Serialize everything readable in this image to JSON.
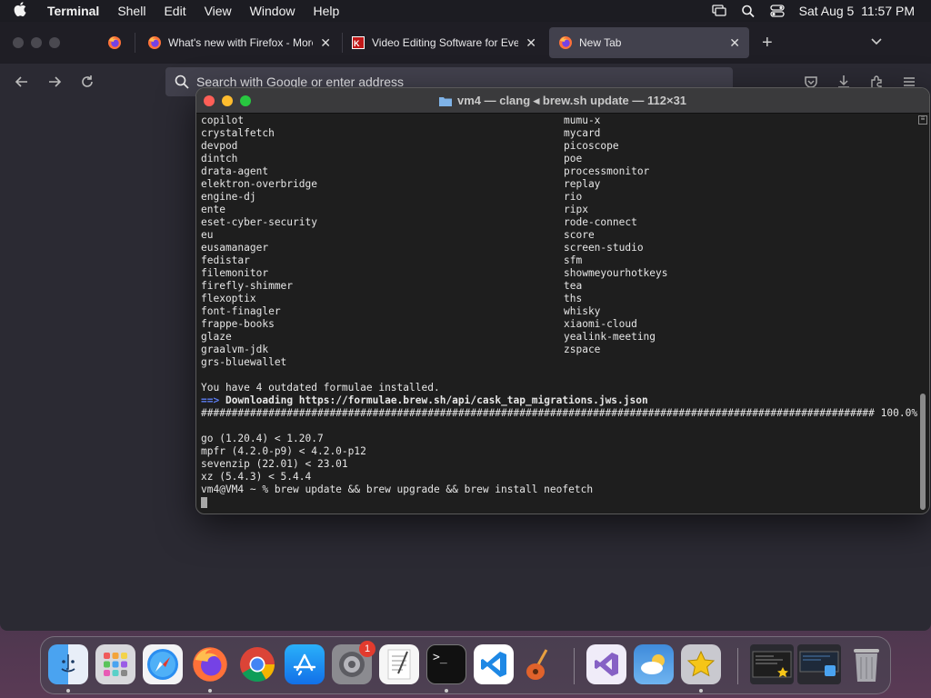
{
  "menubar": {
    "app_name": "Terminal",
    "menus": [
      "Shell",
      "Edit",
      "View",
      "Window",
      "Help"
    ],
    "datetime": "Sat Aug 5  11:57 PM"
  },
  "firefox": {
    "tabs": [
      {
        "title": "What's new with Firefox - More",
        "active": false
      },
      {
        "title": "Video Editing Software for Every",
        "active": false
      },
      {
        "title": "New Tab",
        "active": true
      }
    ],
    "url_placeholder": "Search with Google or enter address"
  },
  "terminal": {
    "title": "vm4 — clang ◂ brew.sh update — 112×31",
    "left_column": [
      "copilot",
      "crystalfetch",
      "devpod",
      "dintch",
      "drata-agent",
      "elektron-overbridge",
      "engine-dj",
      "ente",
      "eset-cyber-security",
      "eu",
      "eusamanager",
      "fedistar",
      "filemonitor",
      "firefly-shimmer",
      "flexoptix",
      "font-finagler",
      "frappe-books",
      "glaze",
      "graalvm-jdk",
      "grs-bluewallet"
    ],
    "right_column": [
      "mumu-x",
      "mycard",
      "picoscope",
      "poe",
      "processmonitor",
      "replay",
      "rio",
      "ripx",
      "rode-connect",
      "score",
      "screen-studio",
      "sfm",
      "showmeyourhotkeys",
      "tea",
      "ths",
      "whisky",
      "xiaomi-cloud",
      "yealink-meeting",
      "zspace"
    ],
    "outdated_msg": "You have 4 outdated formulae installed.",
    "arrow": "==>",
    "download_msg": "Downloading https://formulae.brew.sh/api/cask_tap_migrations.jws.json",
    "progress_bar": "##############################################################################################################",
    "progress_pct": "100.0%",
    "progress_value": 100,
    "outdated": [
      "go (1.20.4) < 1.20.7",
      "mpfr (4.2.0-p9) < 4.2.0-p12",
      "sevenzip (22.01) < 23.01",
      "xz (5.4.3) < 5.4.4"
    ],
    "prompt": "vm4@VM4 ~ % brew update && brew upgrade && brew install neofetch"
  },
  "dock": {
    "apps": [
      "Finder",
      "Launchpad",
      "Safari",
      "Firefox",
      "Chrome",
      "App Store",
      "System Settings",
      "TextEdit",
      "Terminal",
      "VS Code",
      "GarageBand",
      "Visual Studio",
      "Weather",
      "Reeder"
    ],
    "settings_badge": "1"
  },
  "colors": {
    "terminal_bg": "#1e1e1e",
    "arrow_blue": "#5b7cf0",
    "close_red": "#ff5f57",
    "minimize_yellow": "#febc2e",
    "zoom_green": "#28c840"
  }
}
